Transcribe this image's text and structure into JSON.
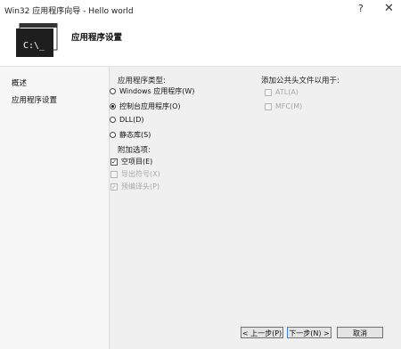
{
  "window": {
    "title": "Win32 应用程序向导 - Hello world",
    "help_glyph": "?",
    "close_glyph": "✕"
  },
  "header": {
    "title": "应用程序设置",
    "console_text": "C:\\_"
  },
  "nav": {
    "items": [
      "概述",
      "应用程序设置"
    ]
  },
  "app_type": {
    "label": "应用程序类型:",
    "options": [
      {
        "label": "Windows 应用程序(W)",
        "checked": false
      },
      {
        "label": "控制台应用程序(O)",
        "checked": true
      },
      {
        "label": "DLL(D)",
        "checked": false
      },
      {
        "label": "静态库(S)",
        "checked": false
      }
    ]
  },
  "extra_options": {
    "label": "附加选项:",
    "options": [
      {
        "label": "空项目(E)",
        "checked": true,
        "enabled": true
      },
      {
        "label": "导出符号(X)",
        "checked": false,
        "enabled": false
      },
      {
        "label": "预编译头(P)",
        "checked": true,
        "enabled": false
      }
    ]
  },
  "common_headers": {
    "label": "添加公共头文件以用于:",
    "options": [
      {
        "label": "ATL(A)",
        "checked": false,
        "enabled": false
      },
      {
        "label": "MFC(M)",
        "checked": false,
        "enabled": false
      }
    ]
  },
  "buttons": {
    "back": "< 上一步(P)",
    "next": "下一步(N) >",
    "cancel": "取消"
  }
}
